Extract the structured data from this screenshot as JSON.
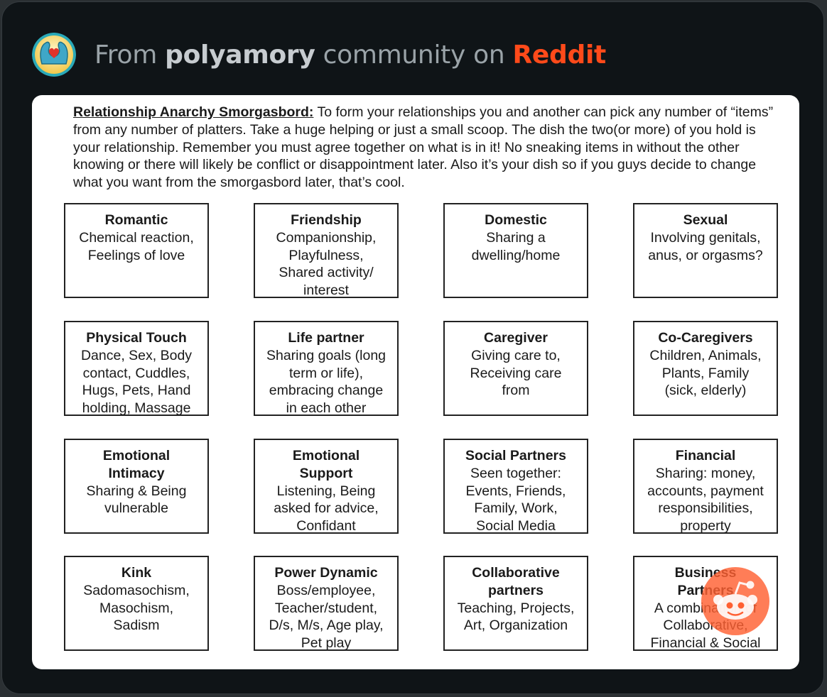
{
  "header": {
    "prefix": "From ",
    "community": "polyamory",
    "middle": " community on ",
    "brand": "Reddit",
    "avatar_icon": "heart-hands-icon",
    "brand_color": "#ff4a1a"
  },
  "document": {
    "title": "Relationship Anarchy Smorgasbord:",
    "intro": "  To form your relationships you and another can pick any number of “items” from any number of platters.  Take a huge helping or just a small scoop.  The dish the two(or more) of you hold is your relationship.  Remember you must agree together on what is in it! No sneaking items in without the other knowing or there will likely be conflict or disappointment later. Also it’s your dish so if you guys decide to change what you want from the smorgasbord later, that’s cool.",
    "boxes": [
      {
        "title": "Romantic",
        "desc": "Chemical reaction,\nFeelings of love"
      },
      {
        "title": "Friendship",
        "desc": "Companionship,\nPlayfulness,\nShared activity/\ninterest"
      },
      {
        "title": "Domestic",
        "desc": "Sharing a\ndwelling/home"
      },
      {
        "title": "Sexual",
        "desc": "Involving genitals,\nanus, or orgasms?"
      },
      {
        "title": "Physical Touch",
        "desc": "Dance, Sex, Body\ncontact, Cuddles,\nHugs, Pets, Hand\nholding, Massage"
      },
      {
        "title": "Life partner",
        "desc": "Sharing goals (long\nterm or life),\nembracing change\nin each other"
      },
      {
        "title": "Caregiver",
        "desc": "Giving care to,\nReceiving care\nfrom"
      },
      {
        "title": "Co-Caregivers",
        "desc": "Children, Animals,\nPlants, Family\n(sick, elderly)"
      },
      {
        "title": "Emotional\nIntimacy",
        "desc": "Sharing & Being\nvulnerable"
      },
      {
        "title": "Emotional\nSupport",
        "desc": "Listening, Being\nasked for advice,\nConfidant"
      },
      {
        "title": "Social Partners",
        "desc": "Seen together:\nEvents, Friends,\nFamily, Work,\nSocial Media"
      },
      {
        "title": "Financial",
        "desc": "Sharing: money,\naccounts, payment\nresponsibilities,\nproperty"
      },
      {
        "title": "Kink",
        "desc": "Sadomasochism,\nMasochism,\nSadism"
      },
      {
        "title": "Power Dynamic",
        "desc": "Boss/employee,\nTeacher/student,\nD/s, M/s, Age play,\nPet play"
      },
      {
        "title": "Collaborative\npartners",
        "desc": "Teaching, Projects,\nArt, Organization"
      },
      {
        "title": "Business\nPartners",
        "desc": "A combination of\nCollaborative,\nFinancial & Social"
      }
    ]
  },
  "watermark": {
    "icon": "reddit-snoo-icon",
    "color": "#ff6032"
  }
}
